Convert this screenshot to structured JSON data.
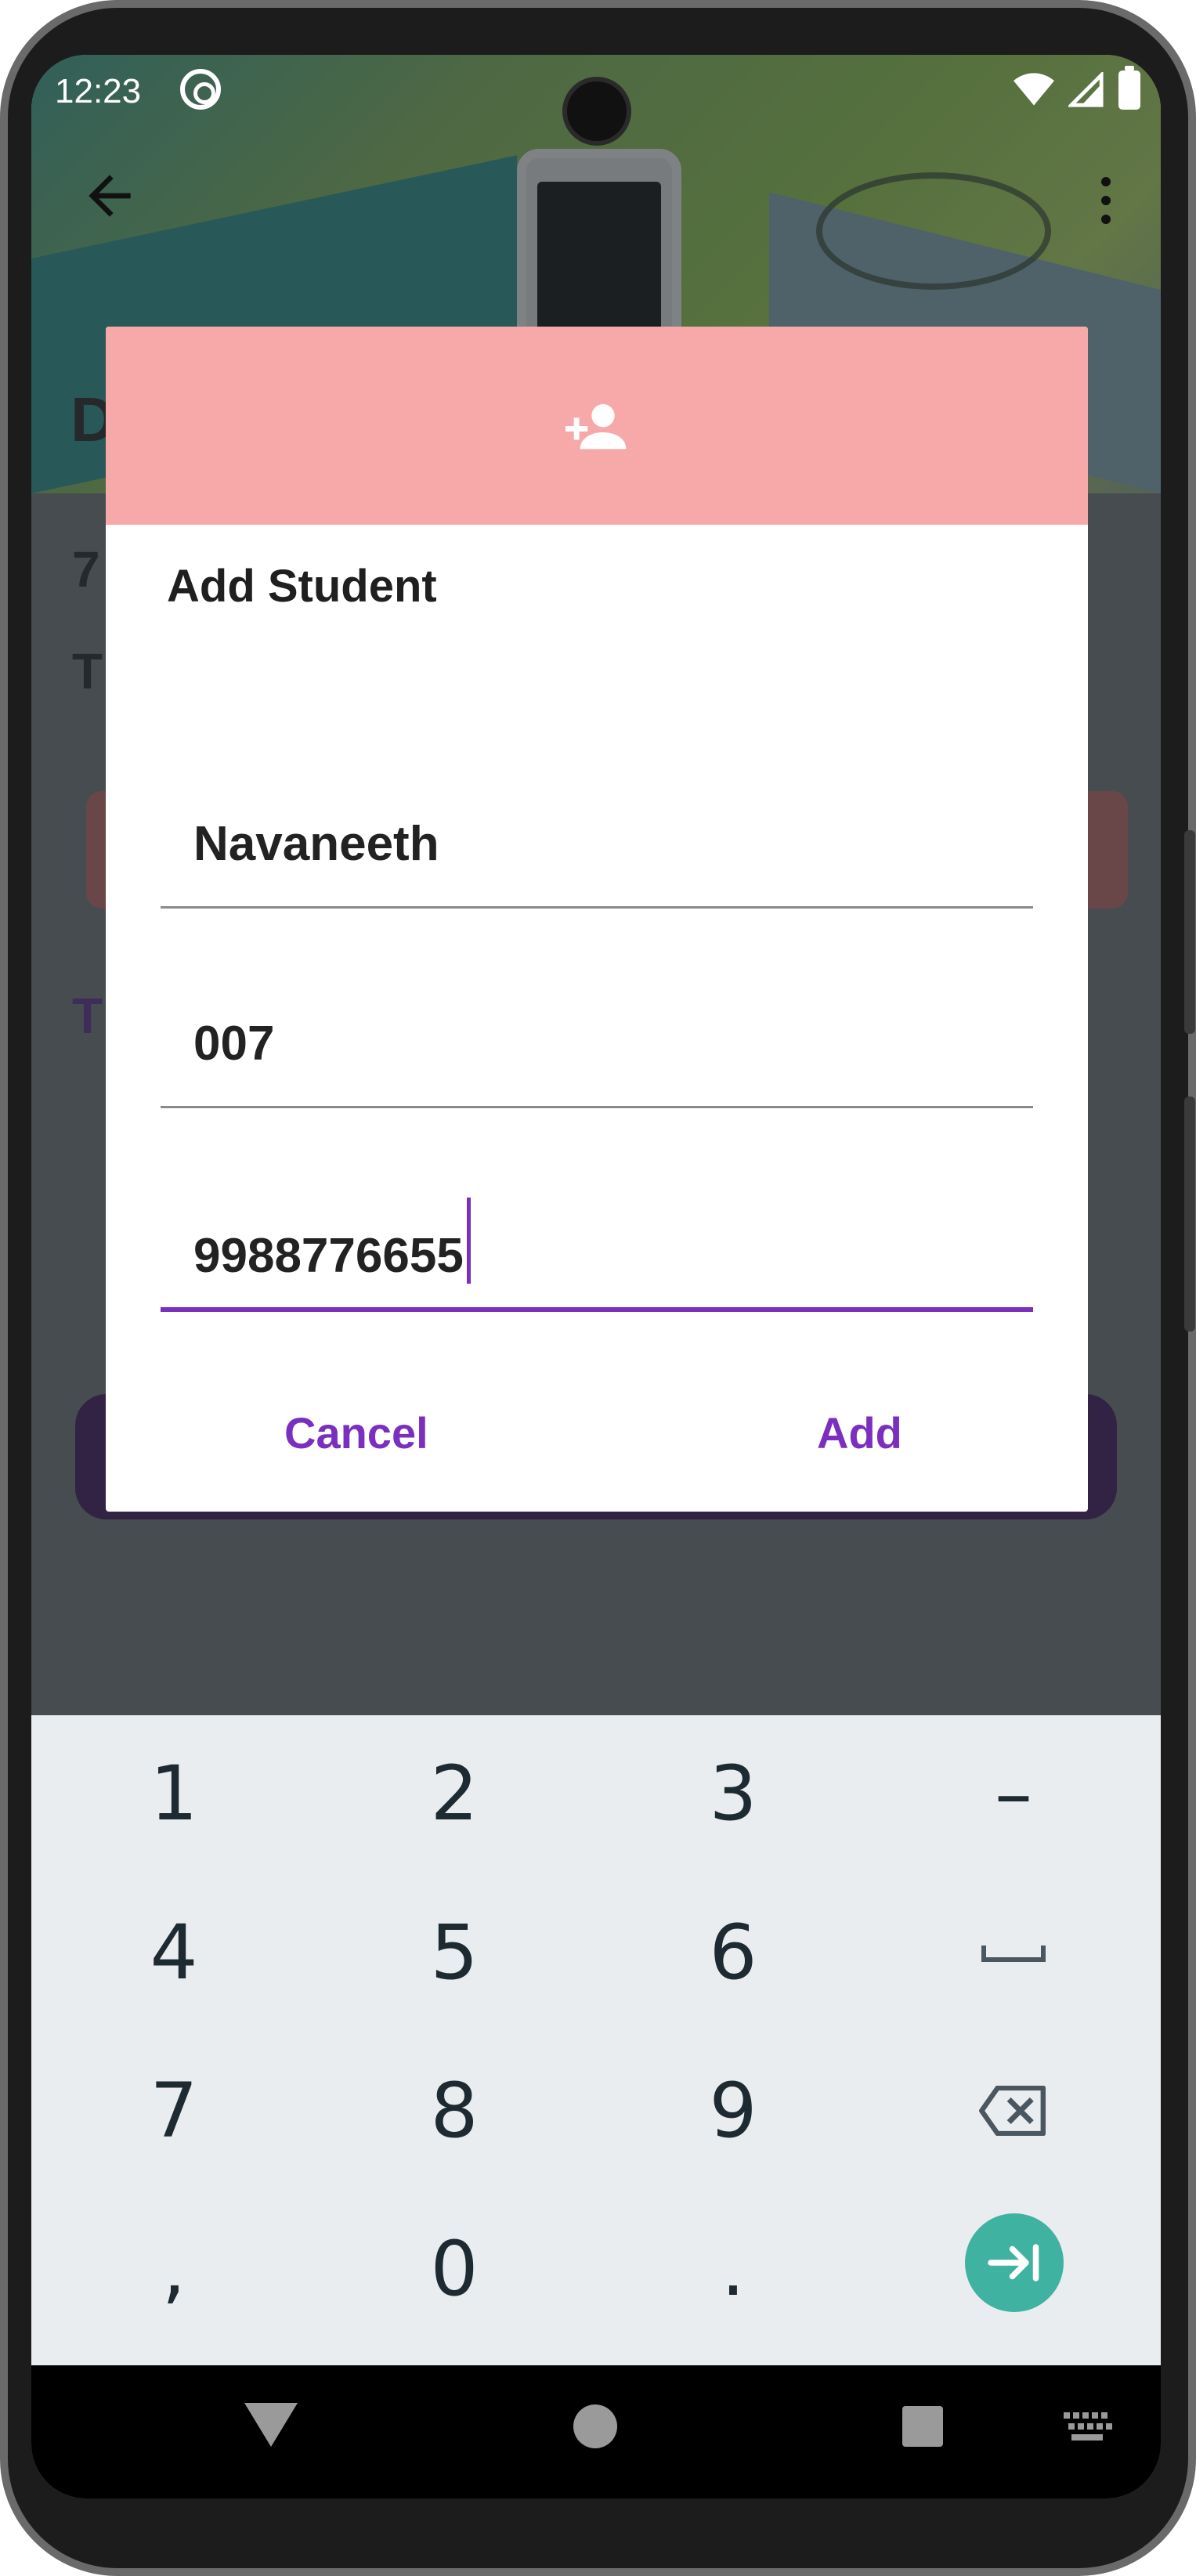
{
  "status_bar": {
    "time": "12:23"
  },
  "background_app": {
    "title_initial": "D",
    "line1_initial": "7",
    "line2_initial": "T",
    "section_initial": "T"
  },
  "dialog": {
    "header_icon": "add-person-icon",
    "title": "Add Student",
    "fields": [
      {
        "value": "Navaneeth"
      },
      {
        "value": "007"
      },
      {
        "value": "9988776655"
      }
    ],
    "cancel_label": "Cancel",
    "add_label": "Add"
  },
  "keyboard": {
    "rows": [
      [
        "1",
        "2",
        "3",
        "–"
      ],
      [
        "4",
        "5",
        "6",
        "space"
      ],
      [
        "7",
        "8",
        "9",
        "backspace"
      ],
      [
        ",",
        "0",
        ".",
        "next"
      ]
    ],
    "labels": {
      "k1": "1",
      "k2": "2",
      "k3": "3",
      "kdash": "–",
      "k4": "4",
      "k5": "5",
      "k6": "6",
      "k7": "7",
      "k8": "8",
      "k9": "9",
      "kcomma": ",",
      "k0": "0",
      "kdot": "."
    },
    "accent_color": "#3fb2a2"
  },
  "colors": {
    "dialog_header": "#f6a9a8",
    "accent": "#7b2fbe"
  }
}
